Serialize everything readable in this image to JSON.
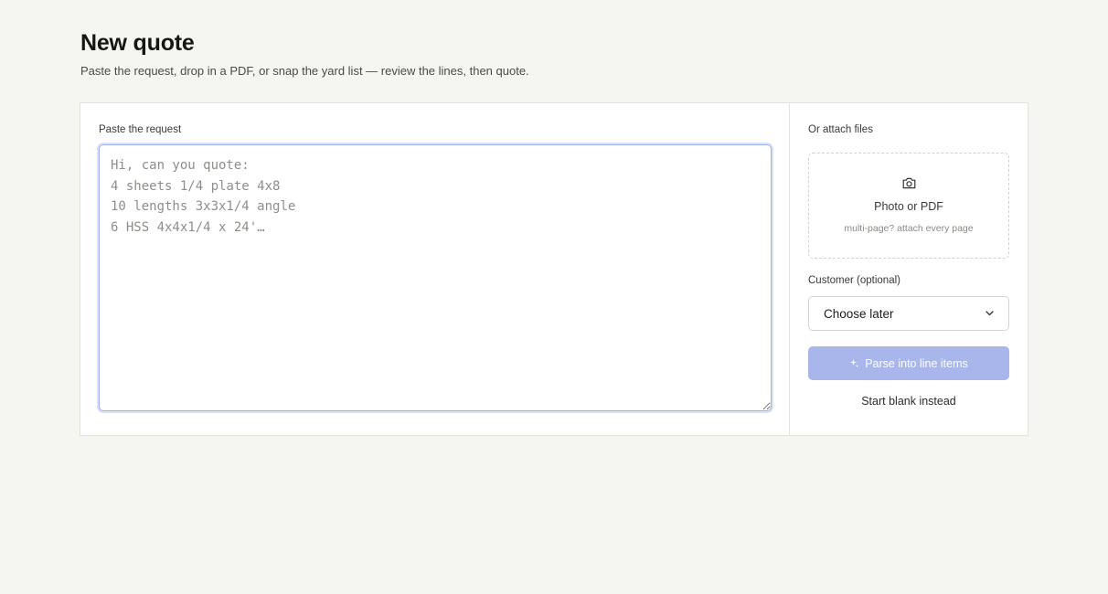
{
  "header": {
    "title": "New quote",
    "subtitle": "Paste the request, drop in a PDF, or snap the yard list — review the lines, then quote."
  },
  "request": {
    "label": "Paste the request",
    "placeholder": "Hi, can you quote:\n4 sheets 1/4 plate 4x8\n10 lengths 3x3x1/4 angle\n6 HSS 4x4x1/4 x 24'…",
    "value": ""
  },
  "attach": {
    "label": "Or attach files",
    "icon": "camera-icon",
    "title": "Photo or PDF",
    "hint": "multi-page? attach every page"
  },
  "customer": {
    "label": "Customer (optional)",
    "selected": "Choose later",
    "icon": "chevron-down-icon"
  },
  "actions": {
    "parse_label": "Parse into line items",
    "parse_icon": "sparkle-icon",
    "parse_color": "#a9b6ec",
    "start_blank_label": "Start blank instead"
  },
  "colors": {
    "page_bg": "#f5f5f1",
    "card_bg": "#ffffff",
    "focus_border": "#9fb0e6"
  }
}
